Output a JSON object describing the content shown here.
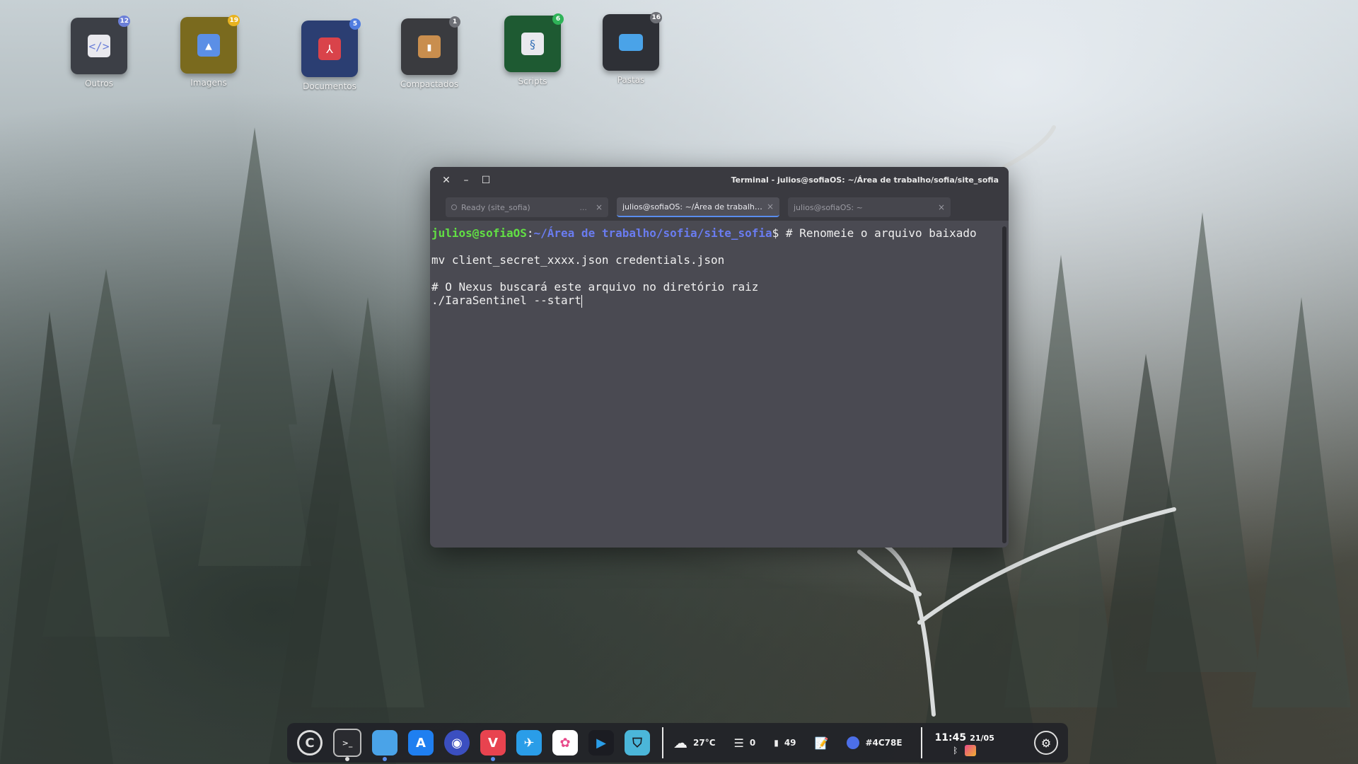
{
  "desktop": {
    "icons": [
      {
        "label": "Outros",
        "badge": "12",
        "icon": "code-file-icon",
        "color": "#3c3f46",
        "badge_color": "#6b7fd8"
      },
      {
        "label": "Imagens",
        "badge": "19",
        "icon": "image-icon",
        "color": "#7a6a1e",
        "badge_color": "#e8b320"
      },
      {
        "label": "Documentos",
        "badge": "5",
        "icon": "pdf-icon",
        "color": "#2b3e72",
        "badge_color": "#4f7ce0"
      },
      {
        "label": "Compactados",
        "badge": "1",
        "icon": "archive-icon",
        "color": "#3a3b3f",
        "badge_color": "#6e7076"
      },
      {
        "label": "Scripts",
        "badge": "6",
        "icon": "python-icon",
        "color": "#1e5a32",
        "badge_color": "#2fb358"
      },
      {
        "label": "Pastas",
        "badge": "16",
        "icon": "folder-icon",
        "color": "#2e3036",
        "badge_color": "#6e7076"
      }
    ]
  },
  "terminal": {
    "title": "Terminal - julios@sofiaOS: ~/Área de trabalho/sofia/site_sofia",
    "tabs": [
      {
        "label": "Ready (site_sofia)",
        "more": "...",
        "close": "×",
        "active": false
      },
      {
        "label": "julios@sofiaOS: ~/Área de trabalho/so...",
        "close": "×",
        "active": true
      },
      {
        "label": "julios@sofiaOS: ~",
        "close": "×",
        "active": false
      }
    ],
    "prompt_user": "julios@sofiaOS",
    "prompt_sep": ":",
    "prompt_path": "~/Área de trabalho/sofia/site_sofia",
    "prompt_end": "$ # Renomeie o arquivo baixado",
    "lines": [
      "",
      "mv client_secret_xxxx.json credentials.json",
      "",
      "# O Nexus buscará este arquivo no diretório raiz",
      "./IaraSentinel --start"
    ]
  },
  "dock": {
    "weather": "27°C",
    "tasks": "0",
    "notes": "49",
    "color_value": "#4C78E",
    "color_swatch": "#4c6fe8",
    "time": "11:45",
    "date": "21/05"
  }
}
